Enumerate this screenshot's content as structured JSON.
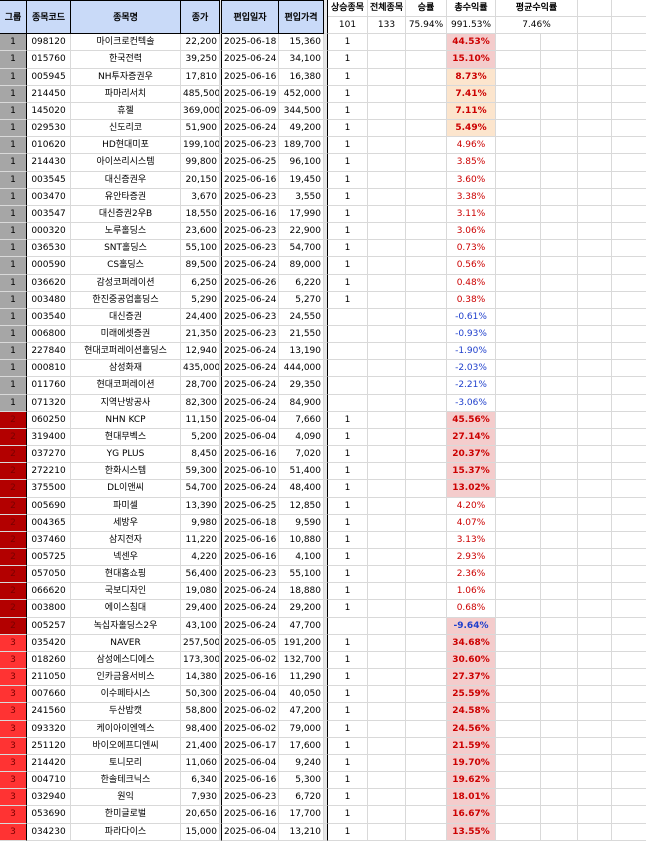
{
  "headers": {
    "group": "그룹",
    "code": "종목코드",
    "name": "종목명",
    "close": "종가",
    "date": "편입일자",
    "entry_price": "편입가격",
    "rising": "상승종목",
    "total": "전체종목",
    "winrate": "승률",
    "total_return": "총수익률",
    "avg_return": "평균수익률"
  },
  "summary": {
    "rising": "101",
    "total": "133",
    "winrate": "75.94%",
    "total_return": "991.53%",
    "avg_return": "7.46%"
  },
  "rows": [
    {
      "g": "1",
      "code": "098120",
      "name": "마이크로컨텍솔",
      "close": "22,200",
      "date": "2025-06-18",
      "entry": "15,360",
      "up": "1",
      "ret": "44.53%",
      "hl": "hi1"
    },
    {
      "g": "1",
      "code": "015760",
      "name": "한국전력",
      "close": "39,250",
      "date": "2025-06-24",
      "entry": "34,100",
      "up": "1",
      "ret": "15.10%",
      "hl": "hi1"
    },
    {
      "g": "1",
      "code": "005945",
      "name": "NH투자증권우",
      "close": "17,810",
      "date": "2025-06-16",
      "entry": "16,380",
      "up": "1",
      "ret": "8.73%",
      "hl": "hi2"
    },
    {
      "g": "1",
      "code": "214450",
      "name": "파마리서치",
      "close": "485,500",
      "date": "2025-06-19",
      "entry": "452,000",
      "up": "1",
      "ret": "7.41%",
      "hl": "hi2"
    },
    {
      "g": "1",
      "code": "145020",
      "name": "휴젤",
      "close": "369,000",
      "date": "2025-06-09",
      "entry": "344,500",
      "up": "1",
      "ret": "7.11%",
      "hl": "hi2"
    },
    {
      "g": "1",
      "code": "029530",
      "name": "신도리코",
      "close": "51,900",
      "date": "2025-06-24",
      "entry": "49,200",
      "up": "1",
      "ret": "5.49%",
      "hl": "hi2"
    },
    {
      "g": "1",
      "code": "010620",
      "name": "HD현대미포",
      "close": "199,100",
      "date": "2025-06-23",
      "entry": "189,700",
      "up": "1",
      "ret": "4.96%",
      "hl": ""
    },
    {
      "g": "1",
      "code": "214430",
      "name": "아이쓰리시스템",
      "close": "99,800",
      "date": "2025-06-25",
      "entry": "96,100",
      "up": "1",
      "ret": "3.85%",
      "hl": ""
    },
    {
      "g": "1",
      "code": "003545",
      "name": "대신증권우",
      "close": "20,150",
      "date": "2025-06-16",
      "entry": "19,450",
      "up": "1",
      "ret": "3.60%",
      "hl": ""
    },
    {
      "g": "1",
      "code": "003470",
      "name": "유안타증권",
      "close": "3,670",
      "date": "2025-06-23",
      "entry": "3,550",
      "up": "1",
      "ret": "3.38%",
      "hl": ""
    },
    {
      "g": "1",
      "code": "003547",
      "name": "대신증권2우B",
      "close": "18,550",
      "date": "2025-06-16",
      "entry": "17,990",
      "up": "1",
      "ret": "3.11%",
      "hl": ""
    },
    {
      "g": "1",
      "code": "000320",
      "name": "노루홀딩스",
      "close": "23,600",
      "date": "2025-06-23",
      "entry": "22,900",
      "up": "1",
      "ret": "3.06%",
      "hl": ""
    },
    {
      "g": "1",
      "code": "036530",
      "name": "SNT홀딩스",
      "close": "55,100",
      "date": "2025-06-23",
      "entry": "54,700",
      "up": "1",
      "ret": "0.73%",
      "hl": ""
    },
    {
      "g": "1",
      "code": "000590",
      "name": "CS홀딩스",
      "close": "89,500",
      "date": "2025-06-24",
      "entry": "89,000",
      "up": "1",
      "ret": "0.56%",
      "hl": ""
    },
    {
      "g": "1",
      "code": "036620",
      "name": "감성코퍼레이션",
      "close": "6,250",
      "date": "2025-06-26",
      "entry": "6,220",
      "up": "1",
      "ret": "0.48%",
      "hl": ""
    },
    {
      "g": "1",
      "code": "003480",
      "name": "한진중공업홀딩스",
      "close": "5,290",
      "date": "2025-06-24",
      "entry": "5,270",
      "up": "1",
      "ret": "0.38%",
      "hl": ""
    },
    {
      "g": "1",
      "code": "003540",
      "name": "대신증권",
      "close": "24,400",
      "date": "2025-06-23",
      "entry": "24,550",
      "up": "",
      "ret": "-0.61%",
      "hl": ""
    },
    {
      "g": "1",
      "code": "006800",
      "name": "미래에셋증권",
      "close": "21,350",
      "date": "2025-06-23",
      "entry": "21,550",
      "up": "",
      "ret": "-0.93%",
      "hl": ""
    },
    {
      "g": "1",
      "code": "227840",
      "name": "현대코퍼레이션홀딩스",
      "close": "12,940",
      "date": "2025-06-24",
      "entry": "13,190",
      "up": "",
      "ret": "-1.90%",
      "hl": ""
    },
    {
      "g": "1",
      "code": "000810",
      "name": "삼성화재",
      "close": "435,000",
      "date": "2025-06-24",
      "entry": "444,000",
      "up": "",
      "ret": "-2.03%",
      "hl": ""
    },
    {
      "g": "1",
      "code": "011760",
      "name": "현대코퍼레이션",
      "close": "28,700",
      "date": "2025-06-24",
      "entry": "29,350",
      "up": "",
      "ret": "-2.21%",
      "hl": ""
    },
    {
      "g": "1",
      "code": "071320",
      "name": "지역난방공사",
      "close": "82,300",
      "date": "2025-06-24",
      "entry": "84,900",
      "up": "",
      "ret": "-3.06%",
      "hl": ""
    },
    {
      "g": "2",
      "code": "060250",
      "name": "NHN KCP",
      "close": "11,150",
      "date": "2025-06-04",
      "entry": "7,660",
      "up": "1",
      "ret": "45.56%",
      "hl": "hi1"
    },
    {
      "g": "2",
      "code": "319400",
      "name": "현대무벡스",
      "close": "5,200",
      "date": "2025-06-04",
      "entry": "4,090",
      "up": "1",
      "ret": "27.14%",
      "hl": "hi1"
    },
    {
      "g": "2",
      "code": "037270",
      "name": "YG PLUS",
      "close": "8,450",
      "date": "2025-06-16",
      "entry": "7,020",
      "up": "1",
      "ret": "20.37%",
      "hl": "hi1"
    },
    {
      "g": "2",
      "code": "272210",
      "name": "한화시스템",
      "close": "59,300",
      "date": "2025-06-10",
      "entry": "51,400",
      "up": "1",
      "ret": "15.37%",
      "hl": "hi1"
    },
    {
      "g": "2",
      "code": "375500",
      "name": "DL이앤씨",
      "close": "54,700",
      "date": "2025-06-24",
      "entry": "48,400",
      "up": "1",
      "ret": "13.02%",
      "hl": "hi1"
    },
    {
      "g": "2",
      "code": "005690",
      "name": "파미셀",
      "close": "13,390",
      "date": "2025-06-25",
      "entry": "12,850",
      "up": "1",
      "ret": "4.20%",
      "hl": ""
    },
    {
      "g": "2",
      "code": "004365",
      "name": "세방우",
      "close": "9,980",
      "date": "2025-06-18",
      "entry": "9,590",
      "up": "1",
      "ret": "4.07%",
      "hl": ""
    },
    {
      "g": "2",
      "code": "037460",
      "name": "삼지전자",
      "close": "11,220",
      "date": "2025-06-16",
      "entry": "10,880",
      "up": "1",
      "ret": "3.13%",
      "hl": ""
    },
    {
      "g": "2",
      "code": "005725",
      "name": "넥센우",
      "close": "4,220",
      "date": "2025-06-16",
      "entry": "4,100",
      "up": "1",
      "ret": "2.93%",
      "hl": ""
    },
    {
      "g": "2",
      "code": "057050",
      "name": "현대홈쇼핑",
      "close": "56,400",
      "date": "2025-06-23",
      "entry": "55,100",
      "up": "1",
      "ret": "2.36%",
      "hl": ""
    },
    {
      "g": "2",
      "code": "066620",
      "name": "국보디자인",
      "close": "19,080",
      "date": "2025-06-24",
      "entry": "18,880",
      "up": "1",
      "ret": "1.06%",
      "hl": ""
    },
    {
      "g": "2",
      "code": "003800",
      "name": "에이스침대",
      "close": "29,400",
      "date": "2025-06-24",
      "entry": "29,200",
      "up": "1",
      "ret": "0.68%",
      "hl": ""
    },
    {
      "g": "2",
      "code": "005257",
      "name": "녹십자홀딩스2우",
      "close": "43,100",
      "date": "2025-06-24",
      "entry": "47,700",
      "up": "",
      "ret": "-9.64%",
      "hl": "hi3"
    },
    {
      "g": "3",
      "code": "035420",
      "name": "NAVER",
      "close": "257,500",
      "date": "2025-06-05",
      "entry": "191,200",
      "up": "1",
      "ret": "34.68%",
      "hl": "hi1"
    },
    {
      "g": "3",
      "code": "018260",
      "name": "삼성에스디에스",
      "close": "173,300",
      "date": "2025-06-02",
      "entry": "132,700",
      "up": "1",
      "ret": "30.60%",
      "hl": "hi1"
    },
    {
      "g": "3",
      "code": "211050",
      "name": "인카금융서비스",
      "close": "14,380",
      "date": "2025-06-16",
      "entry": "11,290",
      "up": "1",
      "ret": "27.37%",
      "hl": "hi1"
    },
    {
      "g": "3",
      "code": "007660",
      "name": "이수페타시스",
      "close": "50,300",
      "date": "2025-06-04",
      "entry": "40,050",
      "up": "1",
      "ret": "25.59%",
      "hl": "hi1"
    },
    {
      "g": "3",
      "code": "241560",
      "name": "두산밥캣",
      "close": "58,800",
      "date": "2025-06-02",
      "entry": "47,200",
      "up": "1",
      "ret": "24.58%",
      "hl": "hi1"
    },
    {
      "g": "3",
      "code": "093320",
      "name": "케이아이엔엑스",
      "close": "98,400",
      "date": "2025-06-02",
      "entry": "79,000",
      "up": "1",
      "ret": "24.56%",
      "hl": "hi1"
    },
    {
      "g": "3",
      "code": "251120",
      "name": "바이오에프디엔씨",
      "close": "21,400",
      "date": "2025-06-17",
      "entry": "17,600",
      "up": "1",
      "ret": "21.59%",
      "hl": "hi1"
    },
    {
      "g": "3",
      "code": "214420",
      "name": "토니모리",
      "close": "11,060",
      "date": "2025-06-04",
      "entry": "9,240",
      "up": "1",
      "ret": "19.70%",
      "hl": "hi1"
    },
    {
      "g": "3",
      "code": "004710",
      "name": "한솔테크닉스",
      "close": "6,340",
      "date": "2025-06-16",
      "entry": "5,300",
      "up": "1",
      "ret": "19.62%",
      "hl": "hi1"
    },
    {
      "g": "3",
      "code": "032940",
      "name": "원익",
      "close": "7,930",
      "date": "2025-06-23",
      "entry": "6,720",
      "up": "1",
      "ret": "18.01%",
      "hl": "hi1"
    },
    {
      "g": "3",
      "code": "053690",
      "name": "한미글로벌",
      "close": "20,650",
      "date": "2025-06-16",
      "entry": "17,700",
      "up": "1",
      "ret": "16.67%",
      "hl": "hi1"
    },
    {
      "g": "3",
      "code": "034230",
      "name": "파라다이스",
      "close": "15,000",
      "date": "2025-06-04",
      "entry": "13,210",
      "up": "1",
      "ret": "13.55%",
      "hl": "hi1"
    }
  ],
  "colors": {
    "header_bg": "#c9daf8",
    "group1": "#a6a6a6",
    "group2": "#b30000",
    "group3": "#ff3333",
    "positive": "#cc0000",
    "negative": "#1f3fcc",
    "highlight_strong": "#f4cccc",
    "highlight_soft": "#fce5cd"
  }
}
